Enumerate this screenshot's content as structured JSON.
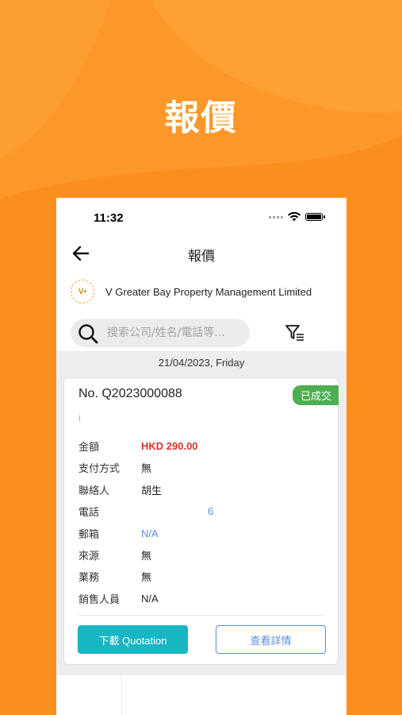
{
  "hero": {
    "title": "報價"
  },
  "status_bar": {
    "time": "11:32"
  },
  "nav": {
    "title": "報價"
  },
  "company": {
    "name": "V Greater Bay Property Management Limited",
    "logo_text": "V•"
  },
  "search": {
    "placeholder": "搜索公司/姓名/電話等..."
  },
  "list": {
    "date_header": "21/04/2023, Friday",
    "card": {
      "number": "No. Q2023000088",
      "status": "已成交",
      "subtitle": "i",
      "fields": [
        {
          "label": "金額",
          "value": "HKD 290.00"
        },
        {
          "label": "支付方式",
          "value": "無"
        },
        {
          "label": "聯絡人",
          "value": "胡生"
        },
        {
          "label": "電話",
          "value": "6"
        },
        {
          "label": "郵箱",
          "value": "N/A"
        },
        {
          "label": "來源",
          "value": "無"
        },
        {
          "label": "業務",
          "value": "無"
        },
        {
          "label": "銷售人員",
          "value": "N/A"
        }
      ],
      "download_label": "下載 Quotation",
      "detail_label": "查看詳情"
    }
  },
  "colors": {
    "background": "#fb8f1e",
    "status_badge": "#4caf50",
    "amount": "#d6332d",
    "link": "#5b8fd6",
    "download_button": "#17b6c2"
  },
  "icons": [
    "back-arrow-icon",
    "search-icon",
    "filter-icon",
    "wifi-icon",
    "battery-icon",
    "signal-icon"
  ]
}
